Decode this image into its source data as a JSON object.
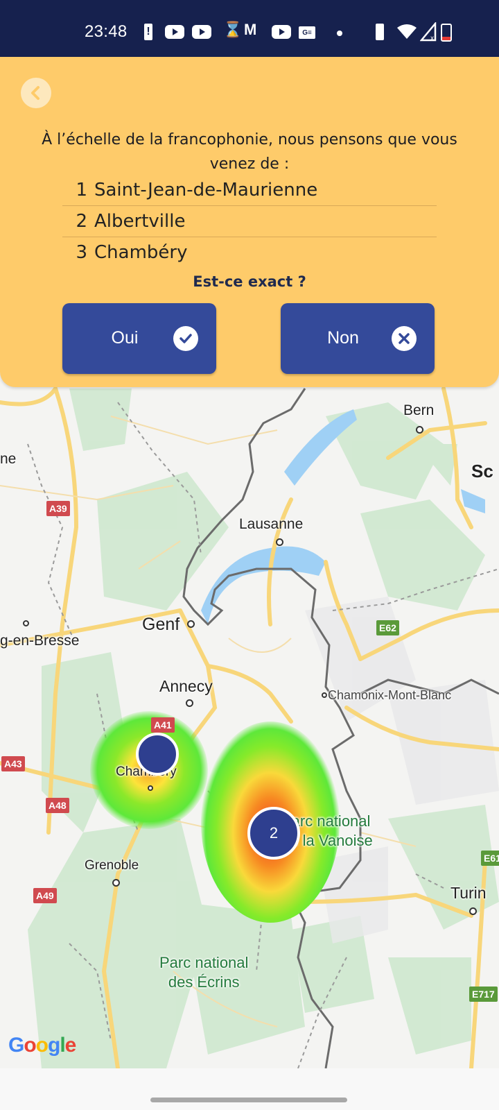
{
  "status_bar": {
    "time": "23:48",
    "icons": [
      "battery-alert-icon",
      "youtube-icon",
      "youtube-icon",
      "hourglass-icon",
      "gmail-icon",
      "youtube-icon",
      "google-news-icon",
      "dot-icon",
      "vibrate-icon",
      "wifi-icon",
      "signal-off-icon",
      "battery-low-icon"
    ]
  },
  "panel": {
    "back_icon": "chevron-left-icon",
    "question": "À l’échelle de la francophonie, nous pensons que vous venez de :",
    "suggestions": [
      {
        "rank": "1",
        "city": "Saint-Jean-de-Maurienne"
      },
      {
        "rank": "2",
        "city": "Albertville"
      },
      {
        "rank": "3",
        "city": "Chambéry"
      }
    ],
    "confirm_question": "Est-ce exact ?",
    "yes_button": {
      "label": "Oui",
      "icon": "check-circle-icon"
    },
    "no_button": {
      "label": "Non",
      "icon": "close-circle-icon"
    }
  },
  "map": {
    "labels": {
      "bern": "Bern",
      "schweiz_partial": "Sc",
      "lyon_partial": "ne",
      "lausanne": "Lausanne",
      "genf": "Genf",
      "bourg": "g-en-Bresse",
      "annecy": "Annecy",
      "chamonix": "Chamonix-Mont-Blanc",
      "chambery": "Chambéry",
      "grenoble": "Grenoble",
      "vanoise": "Parc national\nde la Vanoise",
      "ecrins_1": "Parc national",
      "ecrins_2": "des Écrins",
      "turin": "Turin",
      "google": "Google"
    },
    "road_shields": {
      "a39": "A39",
      "a41": "A41",
      "a43": "A43",
      "a48": "A48",
      "a49": "A49",
      "e62": "E62",
      "e61": "E61",
      "e717": "E717"
    },
    "clusters": [
      {
        "location": "Chambéry",
        "count": ""
      },
      {
        "location": "Parc national de la Vanoise",
        "count": "2"
      }
    ]
  },
  "colors": {
    "status_bar": "#16214e",
    "panel": "#fecb6a",
    "button": "#344a9a",
    "cluster": "#2e3f8f"
  }
}
